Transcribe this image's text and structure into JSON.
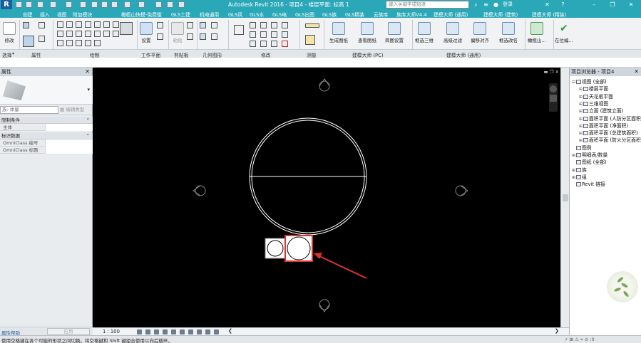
{
  "app": {
    "logo": "R",
    "title": "Autodesk Revit 2016 -   项目4 - 楼层平面: 标高 1",
    "search_placeholder": "键入关键字或短语",
    "login": "登录"
  },
  "tabs": [
    "创建",
    "插入",
    "视图",
    "附加模块",
    "橄榄山快模-免费版",
    "GLS土建",
    "机电通用",
    "GLS风",
    "GLS水",
    "GLS电",
    "GLS出图",
    "GLS族",
    "GLS精装",
    "云族库",
    "族库大师V4.4",
    "建模大师 (通用)",
    "建模大师 (建筑)",
    "建模大师 (精装)"
  ],
  "ribbon": {
    "buttons": {
      "modify": "修改",
      "settings": "设置",
      "paste": "粘贴",
      "generate_sheets": "生成图纸",
      "view_sheets": "查看图纸",
      "simple_setup": "简图设置",
      "pick_3d": "框选三维",
      "advanced_filter": "高级过滤",
      "shift_align": "偏移对齐",
      "pick_rename": "框选改名",
      "olive_mountain": "橄榄山...",
      "in_place": "在位编..."
    },
    "panel_labels": {
      "select": "选择",
      "properties": "属性",
      "draw": "绘制",
      "work_plane": "工作平面",
      "clipboard": "剪贴板",
      "geometry": "几何图形",
      "modify": "修改",
      "measure": "测量",
      "pc": "建模大师 (PC)",
      "general": "建模大师 (通用)"
    }
  },
  "properties": {
    "title": "属性",
    "family": "族: 体量",
    "edit_type": "编辑类型",
    "categories": [
      {
        "name": "限制条件",
        "rows": [
          {
            "key": "主体",
            "value": ""
          }
        ]
      },
      {
        "name": "标识数据",
        "rows": [
          {
            "key": "OmniClass 编号",
            "value": ""
          },
          {
            "key": "OmniClass 标题",
            "value": ""
          }
        ]
      }
    ],
    "help": "属性帮助",
    "apply": "应用"
  },
  "view_bar": {
    "scale": "1 : 100"
  },
  "browser": {
    "title": "项目浏览器 - 项目4",
    "items": [
      {
        "label": "视图 (全部)",
        "level": 0,
        "expander": "−"
      },
      {
        "label": "楼层平面",
        "level": 1,
        "expander": "+"
      },
      {
        "label": "天花板平面",
        "level": 1,
        "expander": "+"
      },
      {
        "label": "三维视图",
        "level": 1,
        "expander": "+"
      },
      {
        "label": "立面 (建筑立面)",
        "level": 1,
        "expander": "+"
      },
      {
        "label": "面积平面 (人防分区面积)",
        "level": 1,
        "expander": "+"
      },
      {
        "label": "面积平面 (净面积)",
        "level": 1,
        "expander": "+"
      },
      {
        "label": "面积平面 (总建筑面积)",
        "level": 1,
        "expander": "+"
      },
      {
        "label": "面积平面 (防火分区面积)",
        "level": 1,
        "expander": "+"
      },
      {
        "label": "图例",
        "level": 0,
        "expander": ""
      },
      {
        "label": "明细表/数量",
        "level": 0,
        "expander": "+"
      },
      {
        "label": "图纸 (全部)",
        "level": 0,
        "expander": ""
      },
      {
        "label": "族",
        "level": 0,
        "expander": "+"
      },
      {
        "label": "组",
        "level": 0,
        "expander": "+"
      },
      {
        "label": "Revit 链接",
        "level": 0,
        "expander": ""
      }
    ]
  },
  "status": {
    "text": "使用空格键在各个可能的形状之间切换。将空格键和 Shift 键组合使用以向后循环。",
    "right_value": ":0"
  },
  "colors": {
    "titlebar": "#2aa8b8",
    "canvas": "#000000",
    "highlight": "#e0312e",
    "arrow": "#e0312e"
  }
}
